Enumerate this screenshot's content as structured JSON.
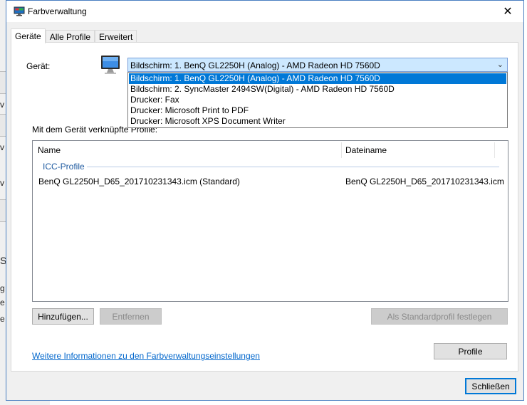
{
  "window": {
    "title": "Farbverwaltung"
  },
  "tabs": [
    {
      "label": "Geräte",
      "active": true
    },
    {
      "label": "Alle Profile",
      "active": false
    },
    {
      "label": "Erweitert",
      "active": false
    }
  ],
  "device": {
    "label": "Gerät:",
    "selected": "Bildschirm: 1. BenQ GL2250H (Analog) - AMD Radeon HD 7560D",
    "options": [
      "Bildschirm: 1. BenQ GL2250H (Analog) - AMD Radeon HD 7560D",
      "Bildschirm: 2. SyncMaster 2494SW(Digital) - AMD Radeon HD 7560D",
      "Drucker: Fax",
      "Drucker: Microsoft Print to PDF",
      "Drucker: Microsoft XPS Document Writer"
    ]
  },
  "profiles": {
    "label": "Mit dem Gerät verknüpfte Profile:",
    "columns": {
      "name": "Name",
      "file": "Dateiname"
    },
    "group": "ICC-Profile",
    "rows": [
      {
        "name": "BenQ GL2250H_D65_201710231343.icm (Standard)",
        "file": "BenQ GL2250H_D65_201710231343.icm"
      }
    ]
  },
  "buttons": {
    "add": "Hinzufügen...",
    "remove": "Entfernen",
    "set_default": "Als Standardprofil festlegen",
    "profiles": "Profile",
    "close": "Schließen"
  },
  "link": "Weitere Informationen zu den Farbverwaltungseinstellungen",
  "background": {
    "chars": [
      "v",
      "v",
      "v",
      "S",
      "g",
      "e",
      "e"
    ]
  }
}
